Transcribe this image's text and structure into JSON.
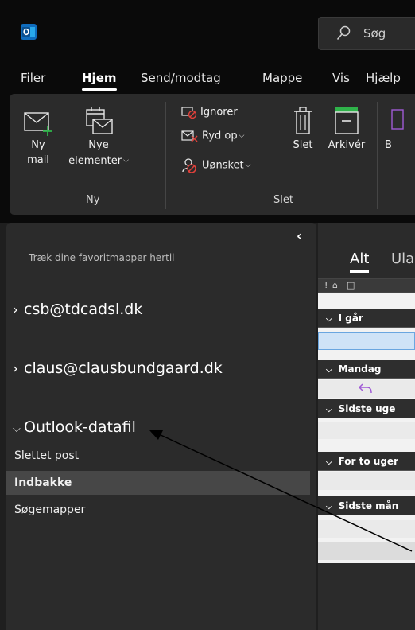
{
  "titlebar": {
    "search_placeholder": "Søg"
  },
  "menu": {
    "tabs": [
      {
        "label": "Filer"
      },
      {
        "label": "Hjem"
      },
      {
        "label": "Send/modtag"
      },
      {
        "label": "Mappe"
      },
      {
        "label": "Vis"
      },
      {
        "label": "Hjælp"
      }
    ],
    "active_tab": "Hjem"
  },
  "ribbon": {
    "new_mail_line1": "Ny",
    "new_mail_line2": "mail",
    "new_items_line1": "Nye",
    "new_items_line2": "elementer",
    "group_new": "Ny",
    "ignore": "Ignorer",
    "cleanup": "Ryd op",
    "junk": "Uønsket",
    "delete": "Slet",
    "archive": "Arkivér",
    "partial": "B",
    "group_delete": "Slet"
  },
  "folder_pane": {
    "favorites_hint": "Træk dine favoritmapper hertil",
    "accounts": [
      {
        "name": "csb@tdcadsl.dk",
        "expanded": false
      },
      {
        "name": "claus@clausbundgaard.dk",
        "expanded": false
      },
      {
        "name": "Outlook-datafil",
        "expanded": true
      }
    ],
    "folders": [
      {
        "label": "Slettet post",
        "selected": false
      },
      {
        "label": "Indbakke",
        "selected": true
      },
      {
        "label": "Søgemapper",
        "selected": false
      }
    ]
  },
  "message_list": {
    "filter_all": "Alt",
    "filter_unread": "Ula",
    "groups": [
      {
        "label": "I går"
      },
      {
        "label": "Mandag"
      },
      {
        "label": "Sidste uge"
      },
      {
        "label": "For to uger"
      },
      {
        "label": "Sidste mån"
      }
    ]
  },
  "colors": {
    "accent_blue": "#0f6cbd",
    "new_item_green": "#2fb34a",
    "junk_red": "#e0403a",
    "reply_purple": "#a05ad6"
  }
}
